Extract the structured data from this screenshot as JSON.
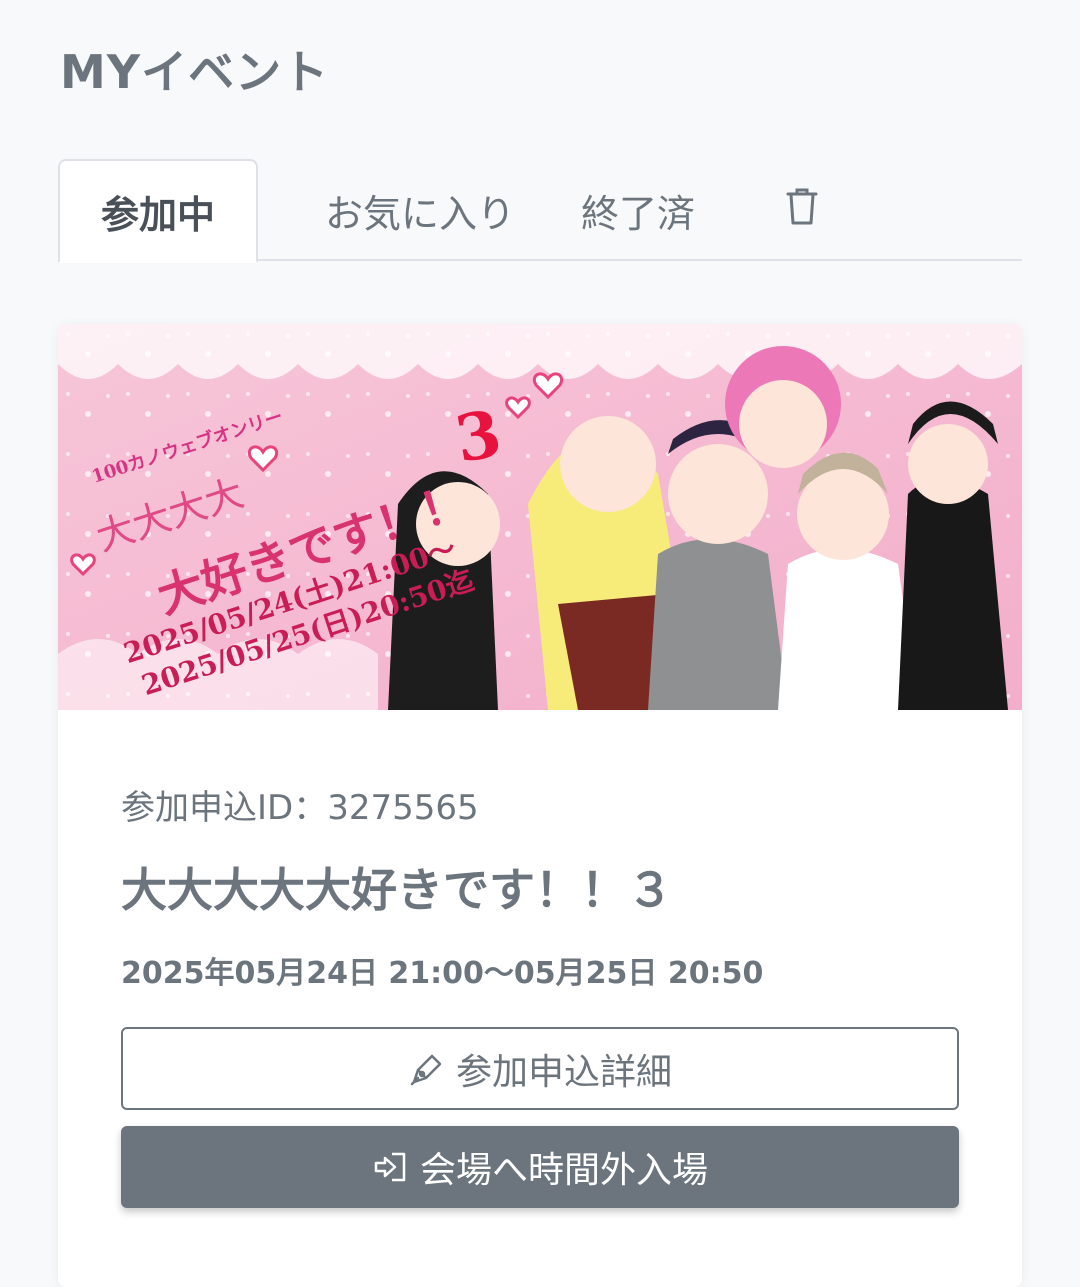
{
  "page": {
    "title": "MYイベント"
  },
  "tabs": {
    "participating": "参加中",
    "favorites": "お気に入り",
    "finished": "終了済"
  },
  "event": {
    "banner": {
      "subtitle": "100カノウェブオンリー",
      "line1": "大大大大",
      "main": "大好きです！！",
      "number": "3",
      "date1": "2025/05/24(土)21:00〜",
      "date2": "2025/05/25(日)20:50迄"
    },
    "application_id": "参加申込ID：3275565",
    "title": "大大大大大好きです！！３",
    "date": "2025年05月24日 21:00〜05月25日 20:50",
    "detail_button": "参加申込詳細",
    "enter_button": "会場へ時間外入場"
  },
  "icons": {
    "trash": "trash-icon",
    "pen": "pen-icon",
    "enter": "enter-icon"
  }
}
